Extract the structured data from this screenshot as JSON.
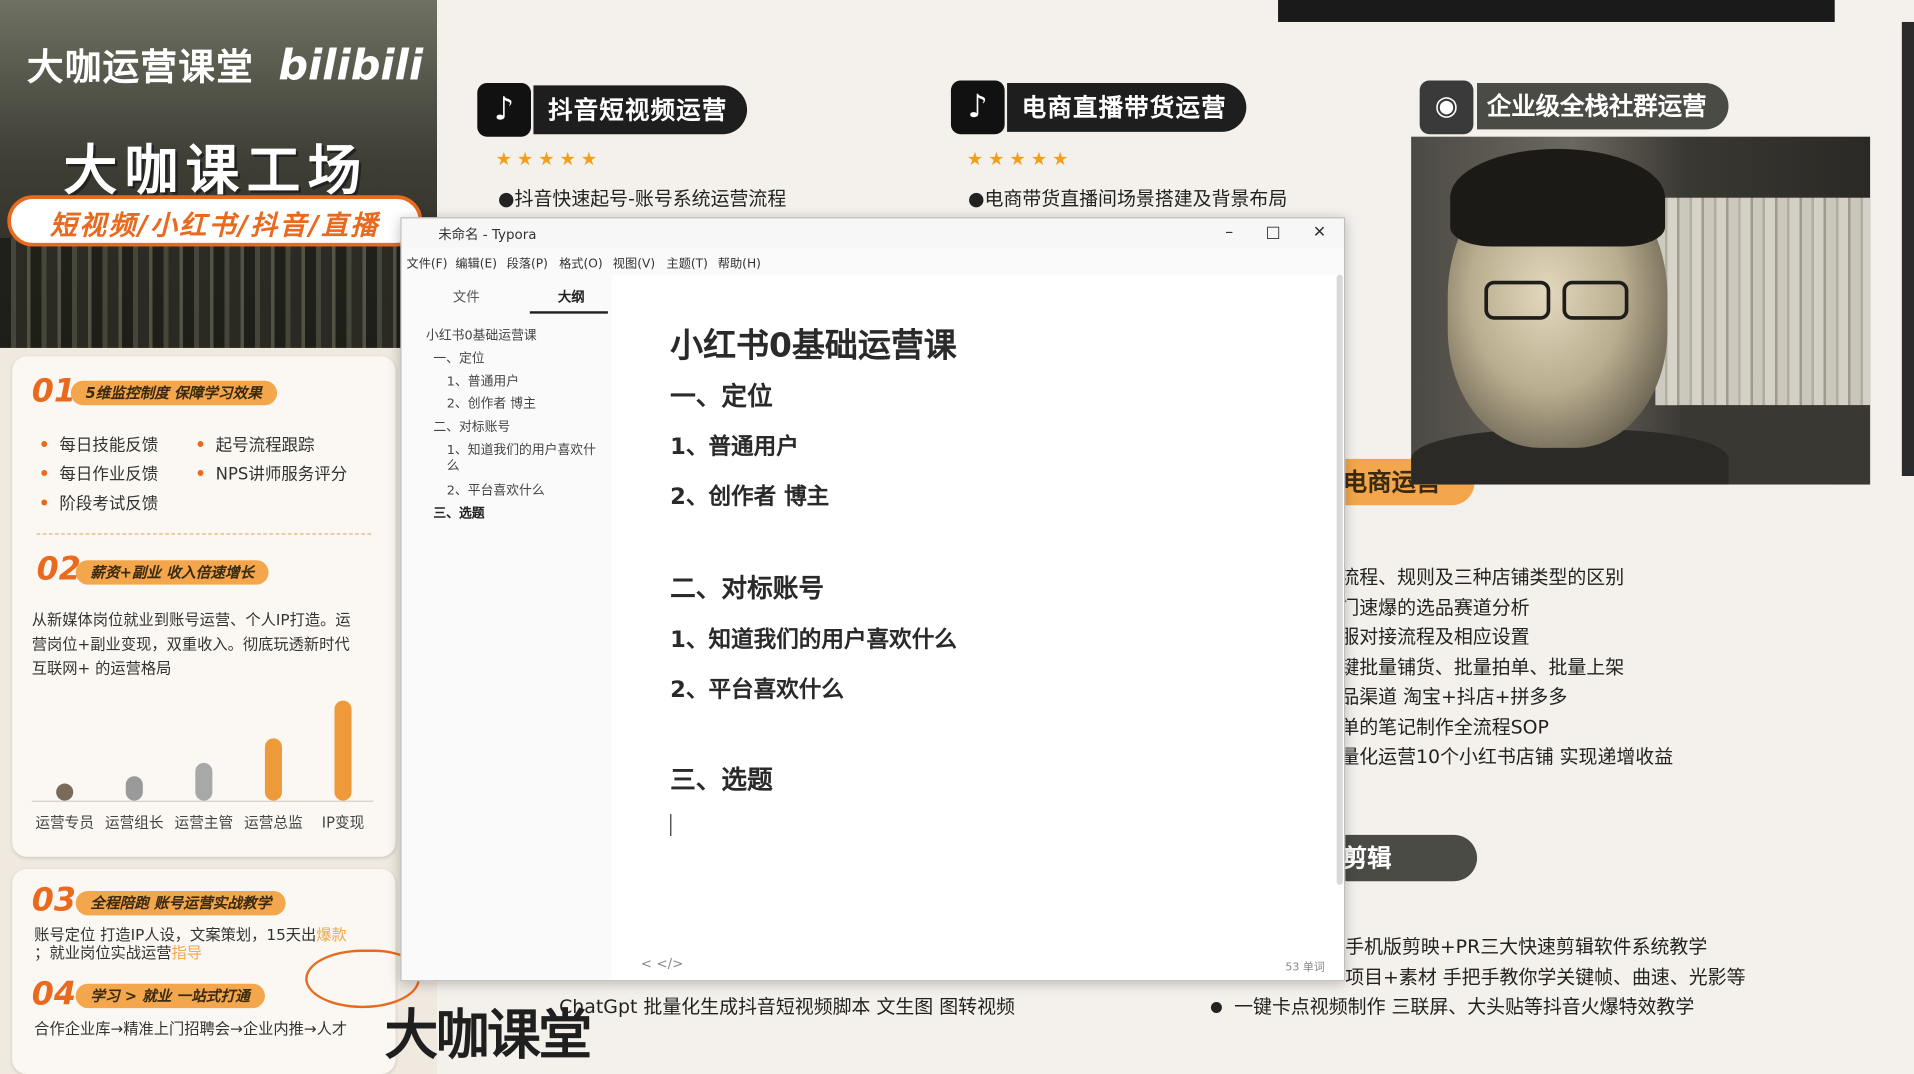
{
  "left": {
    "brand": "大咖运营课堂",
    "brand_sub": "bilibili",
    "hero_title": "大咖课工场",
    "hero_banner": "短视频/小红书/抖音/直播",
    "sec1": {
      "num": "01",
      "title": "5维监控制度 保障学习效果",
      "bullets_left": [
        "每日技能反馈",
        "每日作业反馈",
        "阶段考试反馈"
      ],
      "bullets_right": [
        "起号流程跟踪",
        "NPS讲师服务评分"
      ]
    },
    "sec2": {
      "num": "02",
      "title": "薪资+副业 收入倍速增长",
      "text_lines": [
        "从新媒体岗位就业到账号运营、个人IP打造。运",
        "营岗位+副业变现，双重收入。彻底玩透新时代",
        "互联网+ 的运营格局"
      ],
      "chart_data": {
        "type": "bar",
        "categories": [
          "运营专员",
          "运营组长",
          "运营主管",
          "运营总监",
          "IP变现"
        ],
        "values": [
          1,
          2,
          3,
          5,
          8
        ],
        "colors": [
          "#7a6a5a",
          "#9a9a9a",
          "#a8a8a8",
          "#ef9a3a",
          "#ef9a3a"
        ]
      }
    },
    "sec3": {
      "num": "03",
      "title": "全程陪跑 账号运营实战教学",
      "text_line1": "账号定位 打造IP人设，文案策划，15天出",
      "text_line1_hl": "爆款",
      "text_line2": "；就业岗位实战运营",
      "text_line2_hl": "指导"
    },
    "sec4": {
      "num": "04",
      "title": "学习 > 就业 一站式打通",
      "text_line1": "合作企业库→精准上门招聘会→企业内推→人才"
    },
    "bottom_logo": "大咖课堂"
  },
  "courses": [
    {
      "icon": "♪",
      "title": "抖音短视频运营",
      "stars": "★★★★★",
      "line": "●抖音快速起号-账号系统运营流程"
    },
    {
      "icon": "♪",
      "title": "电商直播带货运营",
      "stars": "★★★★★",
      "line": "●电商带货直播间场景搭建及背景布局"
    },
    {
      "icon": "◉",
      "title": "企业级全栈社群运营"
    }
  ],
  "right": {
    "pill1": "电商运营",
    "lines1": [
      "流程、规则及三种店铺类型的区别",
      "门速爆的选品赛道分析",
      "服对接流程及相应设置",
      "键批量铺货、批量拍单、批量上架",
      "品渠道 淘宝+抖店+拼多多",
      "单的笔记制作全流程SOP",
      "量化运营10个小红书店铺 实现递增收益"
    ],
    "pill2": "剪辑",
    "lines2": [
      "手机版剪映+PR三大快速剪辑软件系统教学",
      "项目+素材 手把手教你学关键帧、曲速、光影等",
      "一键卡点视频制作 三联屏、大头贴等抖音火爆特效教学"
    ],
    "bottom_mid": "ChatGpt 批量化生成抖音短视频脚本 文生图 图转视频"
  },
  "typora": {
    "title": "未命名 - Typora",
    "menus": [
      "文件(F)",
      "编辑(E)",
      "段落(P)",
      "格式(O)",
      "视图(V)",
      "主题(T)",
      "帮助(H)"
    ],
    "side_tabs": [
      "文件",
      "大纲"
    ],
    "outline": [
      "小红书0基础运营课",
      "一、定位",
      "1、普通用户",
      "2、创作者 博主",
      "二、对标账号",
      "1、知道我们的用户喜欢什",
      "么",
      "2、平台喜欢什么",
      "三、选题"
    ],
    "doc": {
      "h1": "小红书0基础运营课",
      "s1": "一、定位",
      "s1_items": [
        "1、普通用户",
        "2、创作者 博主"
      ],
      "s2": "二、对标账号",
      "s2_items": [
        "1、知道我们的用户喜欢什么",
        "2、平台喜欢什么"
      ],
      "s3": "三、选题"
    },
    "footer_left": "<  </>",
    "word_count": "53 单词"
  },
  "colors": {
    "accent": "#e96a1f",
    "pill_orange": "#f3a64b",
    "dark_pill": "#1e1e1e"
  }
}
